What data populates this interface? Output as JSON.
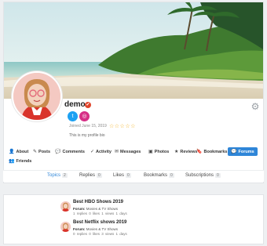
{
  "profile": {
    "name": "demo",
    "joined": "Joined June 15, 2019",
    "bio": "This is my profile bio",
    "rating_stars": 5,
    "stars_text": "☆☆☆☆☆"
  },
  "icons": {
    "verified": "✔",
    "twitter": "t",
    "instagram": "◎",
    "gear": "⚙"
  },
  "nav": [
    {
      "label": "About",
      "icon": "👤"
    },
    {
      "label": "Posts",
      "icon": "✎"
    },
    {
      "label": "Comments",
      "icon": "💬"
    },
    {
      "label": "Activity",
      "icon": "✓"
    },
    {
      "label": "Messages",
      "icon": "✉"
    },
    {
      "label": "Photos",
      "icon": "▣"
    },
    {
      "label": "Reviews",
      "icon": "★"
    },
    {
      "label": "Bookmarks",
      "icon": "🔖"
    },
    {
      "label": "Forums",
      "icon": "💬"
    },
    {
      "label": "Friends",
      "icon": "👥"
    }
  ],
  "tabs": [
    {
      "label": "Topics",
      "count": "2"
    },
    {
      "label": "Replies",
      "count": "0"
    },
    {
      "label": "Likes",
      "count": "0"
    },
    {
      "label": "Bookmarks",
      "count": "0"
    },
    {
      "label": "Subscriptions",
      "count": "0"
    }
  ],
  "topics": [
    {
      "title": "Best HBO Shows 2019",
      "forum_label": "Forum:",
      "forum": "Movies & TV Shows",
      "meta": "1 replies  0 likes  1 views  1 days"
    },
    {
      "title": "Best Netflix shows 2019",
      "forum_label": "Forum:",
      "forum": "Movies & TV Shows",
      "meta": "0 replies  0 likes  3 views  1 days"
    }
  ],
  "colors": {
    "accent": "#2f86d8",
    "verified": "#e0442b",
    "twitter": "#1da1f2",
    "instagram": "#d62e85",
    "stars": "#f2b01e"
  }
}
